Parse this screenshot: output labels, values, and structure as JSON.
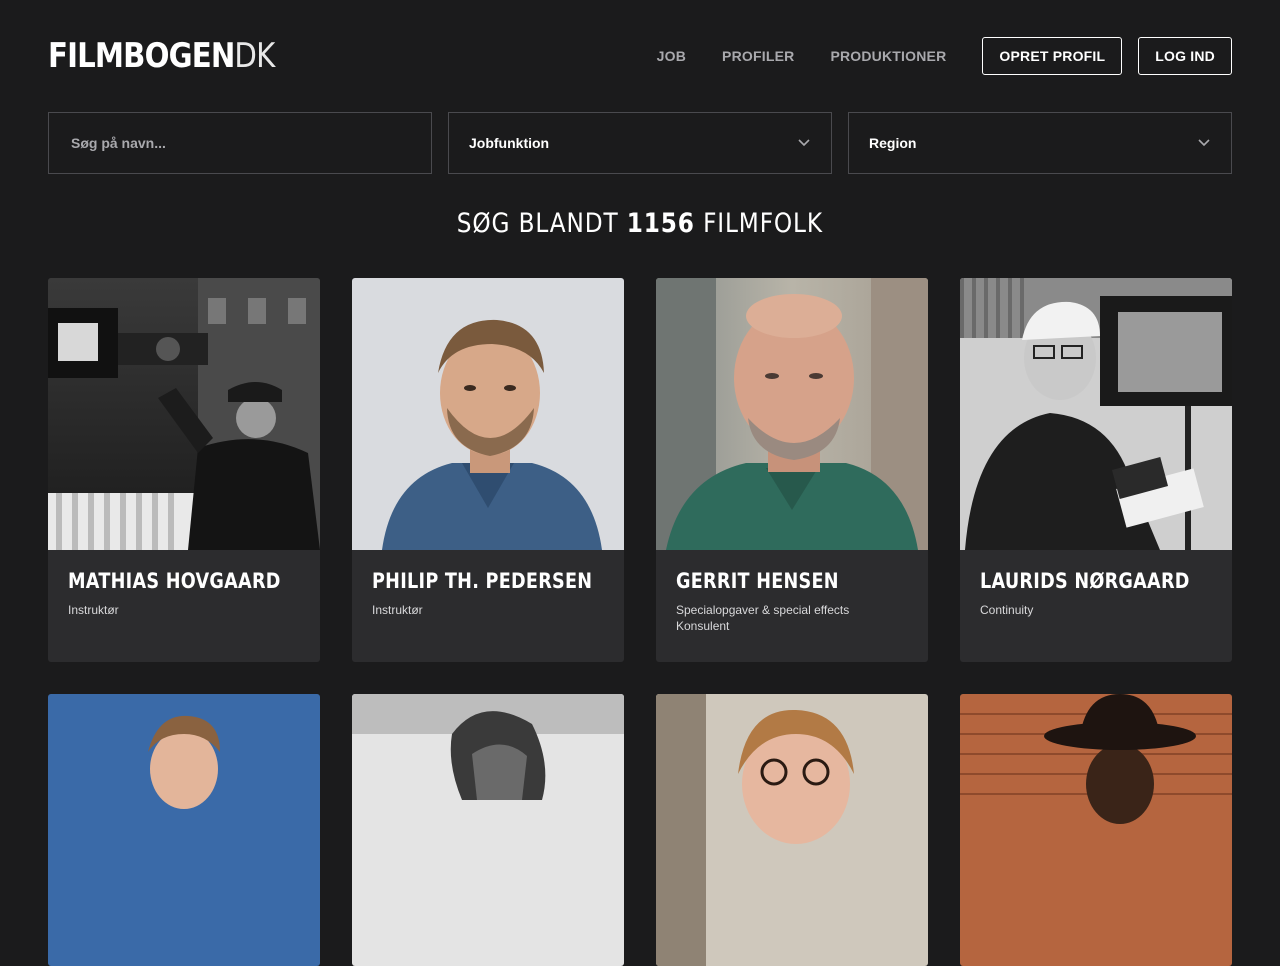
{
  "logo": {
    "bold": "FILMBOGEN",
    "thin": "DK"
  },
  "nav": {
    "job": "JOB",
    "profiles": "PROFILER",
    "productions": "PRODUKTIONER",
    "create_profile": "OPRET PROFIL",
    "login": "LOG IND"
  },
  "filters": {
    "search_placeholder": "Søg på navn...",
    "search_value": "",
    "jobfunction": "Jobfunktion",
    "region": "Region"
  },
  "headline": {
    "prefix": "SØG BLANDT",
    "count": "1156",
    "suffix": "FILMFOLK"
  },
  "profiles": [
    {
      "name": "MATHIAS HOVGAARD",
      "role": "Instruktør"
    },
    {
      "name": "PHILIP TH. PEDERSEN",
      "role": "Instruktør"
    },
    {
      "name": "GERRIT HENSEN",
      "role": "Specialopgaver & special effects",
      "role2": "Konsulent"
    },
    {
      "name": "LAURIDS NØRGAARD",
      "role": "Continuity"
    }
  ],
  "icons": {
    "chevron": "chevron-down-icon"
  },
  "colors": {
    "background": "#1b1b1c",
    "card": "#2c2c2e",
    "nav_text": "#a9a9ad",
    "border": "#4a4a4e"
  }
}
